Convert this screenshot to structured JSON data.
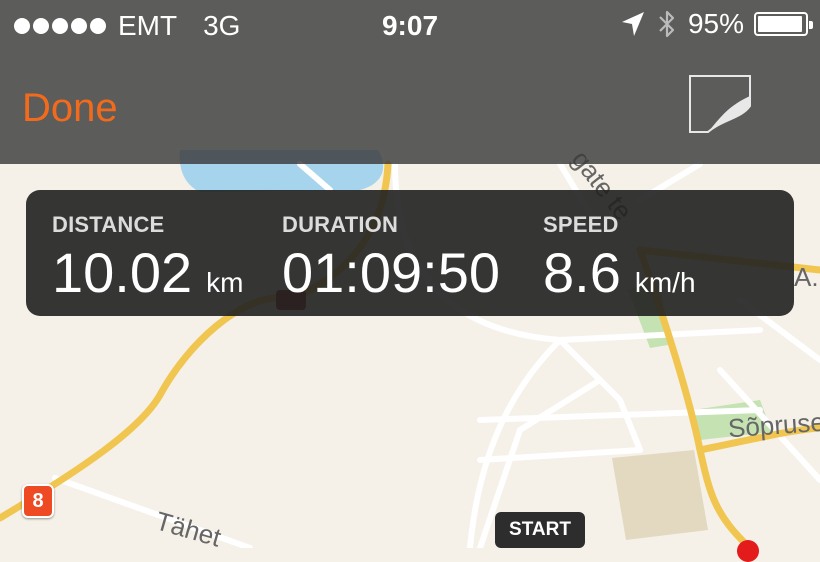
{
  "status_bar": {
    "carrier": "EMT",
    "network": "3G",
    "time": "9:07",
    "battery_percent": "95%",
    "battery_level": 0.95,
    "icons": [
      "signal-dots-icon",
      "location-arrow-icon",
      "bluetooth-icon",
      "battery-icon"
    ]
  },
  "nav": {
    "done_label": "Done",
    "share_icon": "share-page-curl-icon"
  },
  "stats": {
    "distance_label": "DISTANCE",
    "distance_value": "10.02",
    "distance_unit": "km",
    "duration_label": "DURATION",
    "duration_value": "01:09:50",
    "speed_label": "SPEED",
    "speed_value": "8.6",
    "speed_unit": "km/h"
  },
  "map": {
    "start_label": "START",
    "marker_number": "8",
    "streets": [
      "Sõpruse",
      "Tähet",
      "gate te",
      "A."
    ],
    "colors": {
      "background": "#f5f1e8",
      "water": "#a6d4ec",
      "park": "#c5e2b2",
      "route": "#f0c550",
      "accent": "#f26b1d",
      "marker": "#ee4a23",
      "end_pin": "#e31b1b"
    }
  }
}
